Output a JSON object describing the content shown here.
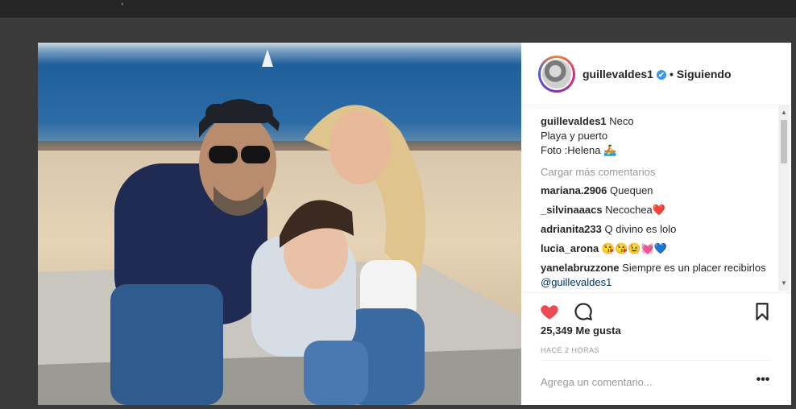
{
  "post": {
    "username": "guillevaldes1",
    "verified_mark": "✔",
    "separator": "•",
    "follow_status": "Siguiendo",
    "caption_user": "guillevaldes1",
    "caption_lines": [
      "Neco",
      "Playa y puerto",
      "Foto :Helena 🚣"
    ],
    "load_more": "Cargar más comentarios",
    "comments": [
      {
        "user": "mariana.2906",
        "text": "Quequen"
      },
      {
        "user": "_silvinaaacs",
        "text": "Necochea❤️"
      },
      {
        "user": "adrianita233",
        "text": "Q divino es lolo"
      },
      {
        "user": "lucia_arona",
        "text": "😘😘😉💓💙"
      },
      {
        "user": "yanelabruzzone",
        "text": "Siempre es un placer recibirlos",
        "mention": "@guillevaldes1"
      }
    ],
    "likes": "25,349 Me gusta",
    "time": "Hace 2 horas",
    "add_comment_placeholder": "Agrega un comentario...",
    "more_label": "•••"
  },
  "icons": {
    "heart": "heart-icon",
    "comment": "comment-icon",
    "bookmark": "bookmark-icon",
    "more": "more-options-icon"
  },
  "colors": {
    "heart": "#ed4956",
    "verified": "#3897f0",
    "mention": "#003569"
  }
}
